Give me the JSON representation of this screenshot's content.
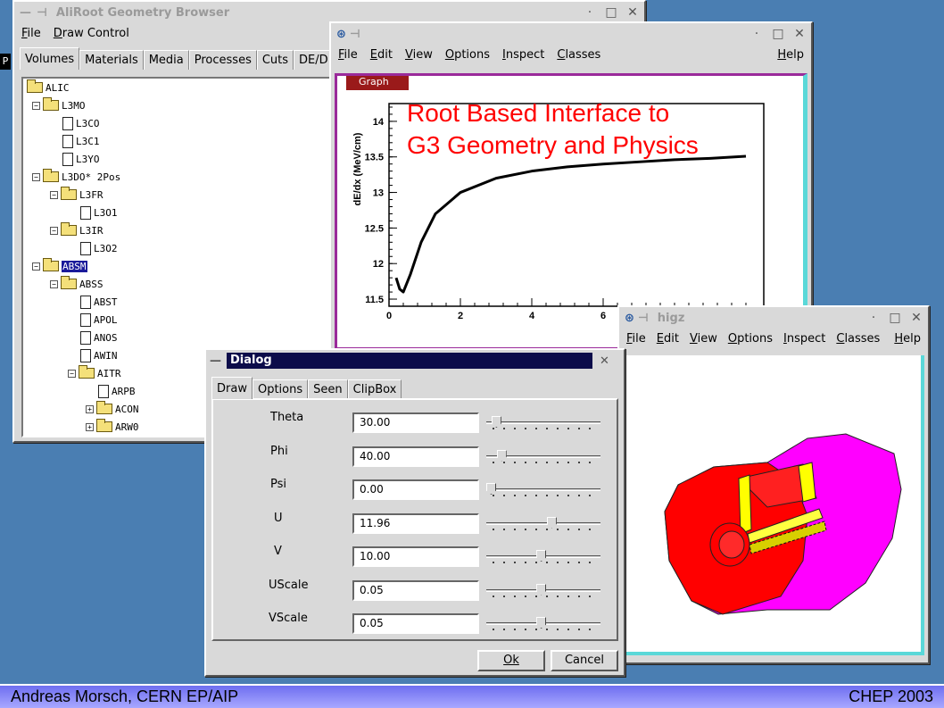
{
  "browser": {
    "title": "AliRoot Geometry Browser",
    "menu": [
      "File",
      "Draw Control"
    ],
    "tabs": [
      "Volumes",
      "Materials",
      "Media",
      "Processes",
      "Cuts",
      "DE/D"
    ],
    "left_marker": "P",
    "tree": [
      "ALIC",
      "L3MO",
      "L3CO",
      "L3C1",
      "L3YO",
      "L3DO* 2Pos",
      "L3FR",
      "L3O1",
      "L3IR",
      "L3O2",
      "ABSM",
      "ABSS",
      "ABST",
      "APOL",
      "ANOS",
      "AWIN",
      "AITR",
      "ARPB",
      "ACON",
      "ARW0"
    ]
  },
  "graph_window": {
    "menu": [
      "File",
      "Edit",
      "View",
      "Options",
      "Inspect",
      "Classes"
    ],
    "help": "Help",
    "graph_tag": "Graph",
    "overlay_line1": "Root Based Interface to",
    "overlay_line2": "G3 Geometry and Physics",
    "overlay_color": "#ff0000"
  },
  "chart_data": {
    "type": "line",
    "title": "",
    "xlabel": "",
    "ylabel": "dE/dx (MeV/cm)",
    "xlim": [
      0,
      10.5
    ],
    "ylim": [
      11.4,
      14.25
    ],
    "x_ticks": [
      "0",
      "2",
      "4",
      "6"
    ],
    "y_ticks": [
      "11.5",
      "12",
      "12.5",
      "13",
      "13.5",
      "14"
    ],
    "series": [
      {
        "x": [
          0.2,
          0.3,
          0.4,
          0.6,
          0.9,
          1.3,
          2,
          3,
          4,
          5,
          6,
          7,
          8,
          9,
          10
        ],
        "y": [
          11.8,
          11.64,
          11.6,
          11.85,
          12.3,
          12.7,
          13.0,
          13.2,
          13.3,
          13.36,
          13.4,
          13.43,
          13.46,
          13.48,
          13.51
        ]
      }
    ]
  },
  "higz": {
    "title": "higz",
    "menu": [
      "File",
      "Edit",
      "View",
      "Options",
      "Inspect",
      "Classes"
    ],
    "help": "Help"
  },
  "dialog": {
    "title": "Dialog",
    "tabs": [
      "Draw",
      "Options",
      "Seen",
      "ClipBox"
    ],
    "fields": [
      {
        "label": "Theta",
        "value": "30.00",
        "level": 0.05
      },
      {
        "label": "Phi",
        "value": "40.00",
        "level": 0.1
      },
      {
        "label": "Psi",
        "value": "0.00",
        "level": 0.0
      },
      {
        "label": "U",
        "value": "11.96",
        "level": 0.58
      },
      {
        "label": "V",
        "value": "10.00",
        "level": 0.48
      },
      {
        "label": "UScale",
        "value": "0.05",
        "level": 0.48
      },
      {
        "label": "VScale",
        "value": "0.05",
        "level": 0.48
      }
    ],
    "ok": "Ok",
    "cancel": "Cancel"
  },
  "footer": {
    "left": "Andreas Morsch, CERN EP/AIP",
    "right": "CHEP 2003"
  }
}
